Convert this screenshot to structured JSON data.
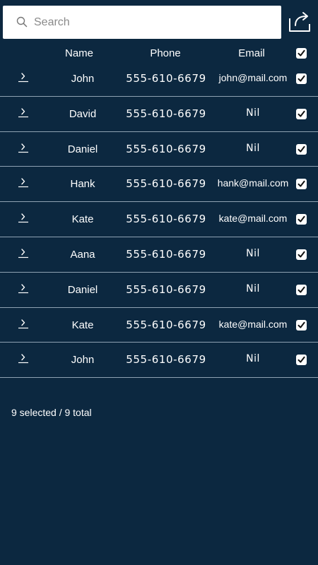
{
  "search": {
    "placeholder": "Search",
    "value": ""
  },
  "icons": {
    "search": "search-icon",
    "share": "share-icon",
    "expand": "chevron-right-icon",
    "check": "checkbox-checked-icon"
  },
  "colors": {
    "background": "#0c2840",
    "divider": "#8fa2b3",
    "text": "#ffffff"
  },
  "table": {
    "headers": {
      "name": "Name",
      "phone": "Phone",
      "email": "Email"
    },
    "select_all_checked": true,
    "rows": [
      {
        "name": "John",
        "phone": "555-610-6679",
        "email": "john@mail.com",
        "checked": true
      },
      {
        "name": "David",
        "phone": "555-610-6679",
        "email": "Nil",
        "checked": true
      },
      {
        "name": "Daniel",
        "phone": "555-610-6679",
        "email": "Nil",
        "checked": true
      },
      {
        "name": "Hank",
        "phone": "555-610-6679",
        "email": "hank@mail.com",
        "checked": true
      },
      {
        "name": "Kate",
        "phone": "555-610-6679",
        "email": "kate@mail.com",
        "checked": true
      },
      {
        "name": "Aana",
        "phone": "555-610-6679",
        "email": "Nil",
        "checked": true
      },
      {
        "name": "Daniel",
        "phone": "555-610-6679",
        "email": "Nil",
        "checked": true
      },
      {
        "name": "Kate",
        "phone": "555-610-6679",
        "email": "kate@mail.com",
        "checked": true
      },
      {
        "name": "John",
        "phone": "555-610-6679",
        "email": "Nil",
        "checked": true
      }
    ]
  },
  "footer": {
    "status": "9 selected / 9 total"
  }
}
